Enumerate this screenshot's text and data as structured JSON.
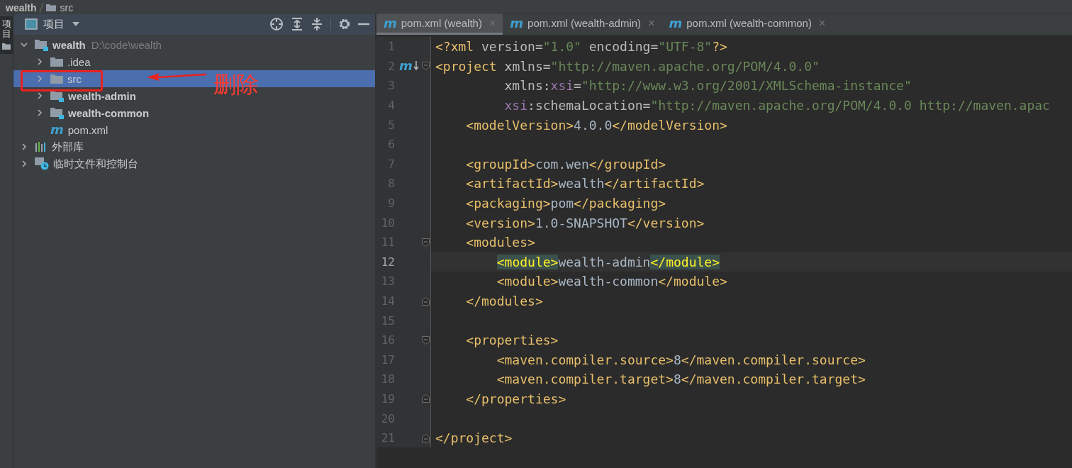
{
  "breadcrumb": [
    {
      "label": "wealth"
    },
    {
      "label": "src"
    }
  ],
  "tool_stripe": {
    "label": "项目",
    "selected": true
  },
  "project_panel": {
    "title": "项目",
    "tree": [
      {
        "name": "wealth",
        "kind": "project",
        "bold": true,
        "path": "D:\\code\\wealth",
        "expanded": true,
        "selected": false,
        "children": [
          {
            "name": ".idea",
            "kind": "folder",
            "bold": false,
            "expanded": false,
            "selected": false
          },
          {
            "name": "src",
            "kind": "folder",
            "bold": false,
            "expanded": false,
            "selected": true
          },
          {
            "name": "wealth-admin",
            "kind": "module",
            "bold": true,
            "expanded": false,
            "selected": false
          },
          {
            "name": "wealth-common",
            "kind": "module",
            "bold": true,
            "expanded": false,
            "selected": false
          },
          {
            "name": "pom.xml",
            "kind": "maven",
            "icon": "m",
            "bold": false,
            "selected": false
          }
        ]
      },
      {
        "name": "外部库",
        "kind": "libraries",
        "bold": false,
        "expanded": false,
        "selected": false
      },
      {
        "name": "临时文件和控制台",
        "kind": "scratches",
        "bold": false,
        "expanded": false,
        "selected": false
      }
    ],
    "annotation": {
      "text": "删除"
    }
  },
  "tabs": [
    {
      "label": "pom.xml (wealth)",
      "icon": "m",
      "close": "×",
      "selected": true
    },
    {
      "label": "pom.xml (wealth-admin)",
      "icon": "m",
      "close": "×",
      "selected": false
    },
    {
      "label": "pom.xml (wealth-common)",
      "icon": "m",
      "close": "×",
      "selected": false
    }
  ],
  "editor": {
    "lines": [
      {
        "number": "1",
        "current": false,
        "tokens": [
          {
            "kind": "tag",
            "text": "<?xml"
          },
          {
            "kind": "attr",
            "text": " version="
          },
          {
            "kind": "str",
            "text": "\"1.0\""
          },
          {
            "kind": "attr",
            "text": " encoding="
          },
          {
            "kind": "str",
            "text": "\"UTF-8\""
          },
          {
            "kind": "tag",
            "text": "?>"
          }
        ]
      },
      {
        "number": "2",
        "current": false,
        "marker": "m",
        "fold": {
          "kind": "open"
        },
        "tokens": [
          {
            "kind": "tag",
            "text": "<project"
          },
          {
            "kind": "attr",
            "text": " xmlns="
          },
          {
            "kind": "str",
            "text": "\"http://maven.apache.org/POM/4.0.0\""
          }
        ]
      },
      {
        "number": "3",
        "current": false,
        "tokens": [
          {
            "kind": "attr",
            "text": "         xmlns:"
          },
          {
            "kind": "ns",
            "text": "xsi"
          },
          {
            "kind": "attr",
            "text": "="
          },
          {
            "kind": "str",
            "text": "\"http://www.w3.org/2001/XMLSchema-instance\""
          }
        ]
      },
      {
        "number": "4",
        "current": false,
        "tokens": [
          {
            "kind": "ns",
            "text": "         xsi"
          },
          {
            "kind": "attr",
            "text": ":schemaLocation="
          },
          {
            "kind": "str",
            "text": "\"http://maven.apache.org/POM/4.0.0 http://maven.apac"
          }
        ]
      },
      {
        "number": "5",
        "current": false,
        "tokens": [
          {
            "kind": "tag",
            "text": "    <modelVersion>"
          },
          {
            "kind": "text",
            "text": "4.0.0"
          },
          {
            "kind": "tag",
            "text": "</modelVersion>"
          }
        ]
      },
      {
        "number": "6",
        "current": false
      },
      {
        "number": "7",
        "current": false,
        "tokens": [
          {
            "kind": "tag",
            "text": "    <groupId>"
          },
          {
            "kind": "text",
            "text": "com.wen"
          },
          {
            "kind": "tag",
            "text": "</groupId>"
          }
        ]
      },
      {
        "number": "8",
        "current": false,
        "tokens": [
          {
            "kind": "tag",
            "text": "    <artifactId>"
          },
          {
            "kind": "text",
            "text": "wealth"
          },
          {
            "kind": "tag",
            "text": "</artifactId>"
          }
        ]
      },
      {
        "number": "9",
        "current": false,
        "tokens": [
          {
            "kind": "tag",
            "text": "    <packaging>"
          },
          {
            "kind": "text",
            "text": "pom"
          },
          {
            "kind": "tag",
            "text": "</packaging>"
          }
        ]
      },
      {
        "number": "10",
        "current": false,
        "tokens": [
          {
            "kind": "tag",
            "text": "    <version>"
          },
          {
            "kind": "text",
            "text": "1.0-SNAPSHOT"
          },
          {
            "kind": "tag",
            "text": "</version>"
          }
        ]
      },
      {
        "number": "11",
        "current": false,
        "fold": {
          "kind": "open"
        },
        "tokens": [
          {
            "kind": "tag",
            "text": "    <modules>"
          }
        ]
      },
      {
        "number": "12",
        "current": true,
        "tokens": [
          {
            "kind": "match",
            "text": "        <module>"
          },
          {
            "kind": "text",
            "text": "wealth-admin"
          },
          {
            "kind": "match",
            "text": "</module>"
          }
        ]
      },
      {
        "number": "13",
        "current": false,
        "tokens": [
          {
            "kind": "tag",
            "text": "        <module>"
          },
          {
            "kind": "text",
            "text": "wealth-common"
          },
          {
            "kind": "tag",
            "text": "</module>"
          }
        ]
      },
      {
        "number": "14",
        "current": false,
        "fold": {
          "kind": "close"
        },
        "tokens": [
          {
            "kind": "tag",
            "text": "    </modules>"
          }
        ]
      },
      {
        "number": "15",
        "current": false
      },
      {
        "number": "16",
        "current": false,
        "fold": {
          "kind": "open"
        },
        "tokens": [
          {
            "kind": "tag",
            "text": "    <properties>"
          }
        ]
      },
      {
        "number": "17",
        "current": false,
        "tokens": [
          {
            "kind": "tag",
            "text": "        <maven.compiler.source>"
          },
          {
            "kind": "text",
            "text": "8"
          },
          {
            "kind": "tag",
            "text": "</maven.compiler.source>"
          }
        ]
      },
      {
        "number": "18",
        "current": false,
        "tokens": [
          {
            "kind": "tag",
            "text": "        <maven.compiler.target>"
          },
          {
            "kind": "text",
            "text": "8"
          },
          {
            "kind": "tag",
            "text": "</maven.compiler.target>"
          }
        ]
      },
      {
        "number": "19",
        "current": false,
        "fold": {
          "kind": "close"
        },
        "tokens": [
          {
            "kind": "tag",
            "text": "    </properties>"
          }
        ]
      },
      {
        "number": "20",
        "current": false
      },
      {
        "number": "21",
        "current": false,
        "fold": {
          "kind": "close"
        },
        "tokens": [
          {
            "kind": "tag",
            "text": "</project>"
          }
        ]
      }
    ]
  }
}
